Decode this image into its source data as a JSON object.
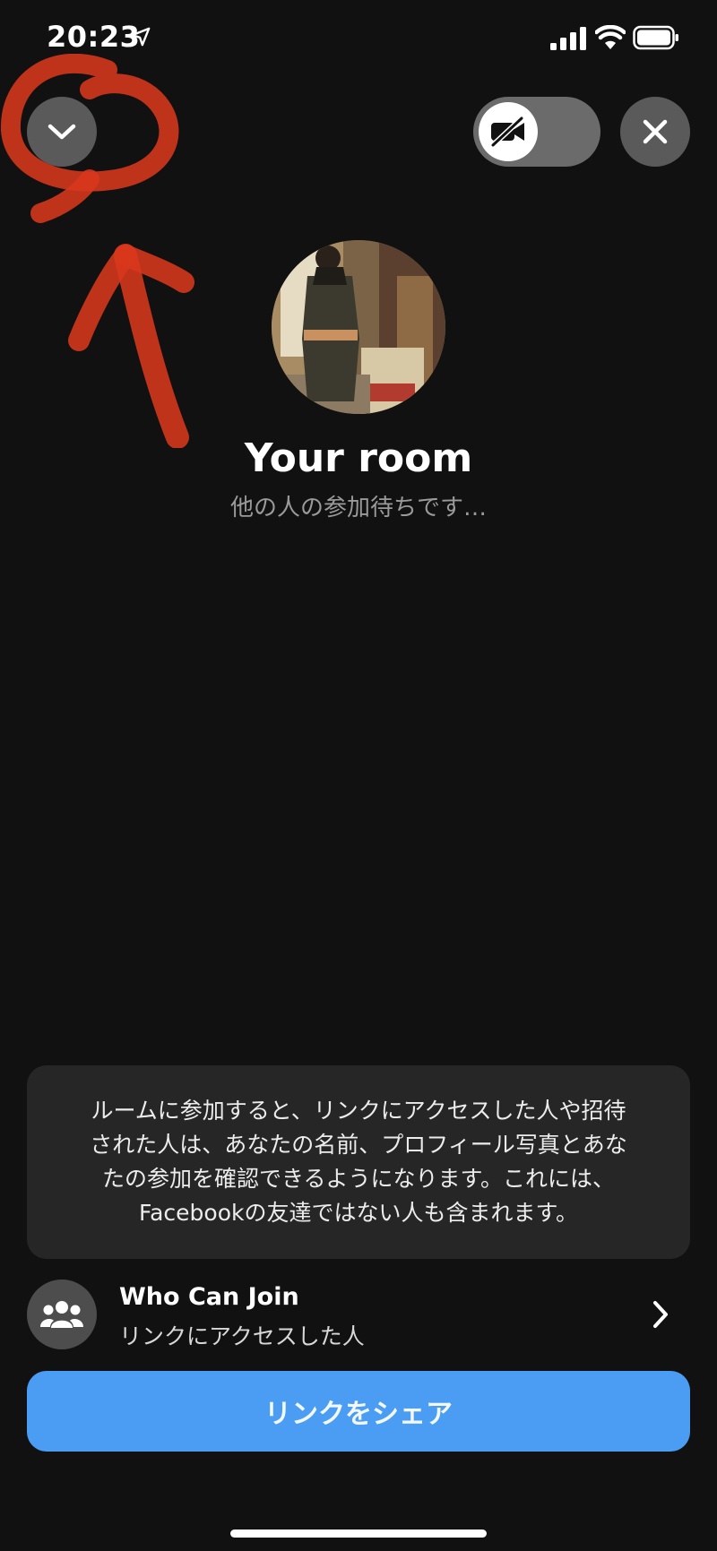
{
  "status_bar": {
    "time": "20:23",
    "icons": [
      "location-arrow-icon",
      "cellular-signal-icon",
      "wifi-icon",
      "battery-icon"
    ]
  },
  "controls": {
    "collapse_icon": "chevron-down-icon",
    "video_toggle_icon": "video-off-icon",
    "video_enabled": false,
    "close_icon": "close-icon"
  },
  "room": {
    "title": "Your room",
    "subtitle": "他の人の参加待ちです…"
  },
  "notice": {
    "lines": [
      "ルームに参加すると、リンクにアクセスした人や招待",
      "された人は、あなたの名前、プロフィール写真とあな",
      "たの参加を確認できるようになります。これには、",
      "Facebookの友達ではない人も含まれます。"
    ]
  },
  "who_can_join": {
    "icon": "group-icon",
    "title": "Who Can Join",
    "value": "リンクにアクセスした人",
    "chevron": "chevron-right-icon"
  },
  "share_button": {
    "label": "リンクをシェア"
  },
  "colors": {
    "background": "#111111",
    "accent": "#4a9df3",
    "annotation": "#d8381c"
  }
}
